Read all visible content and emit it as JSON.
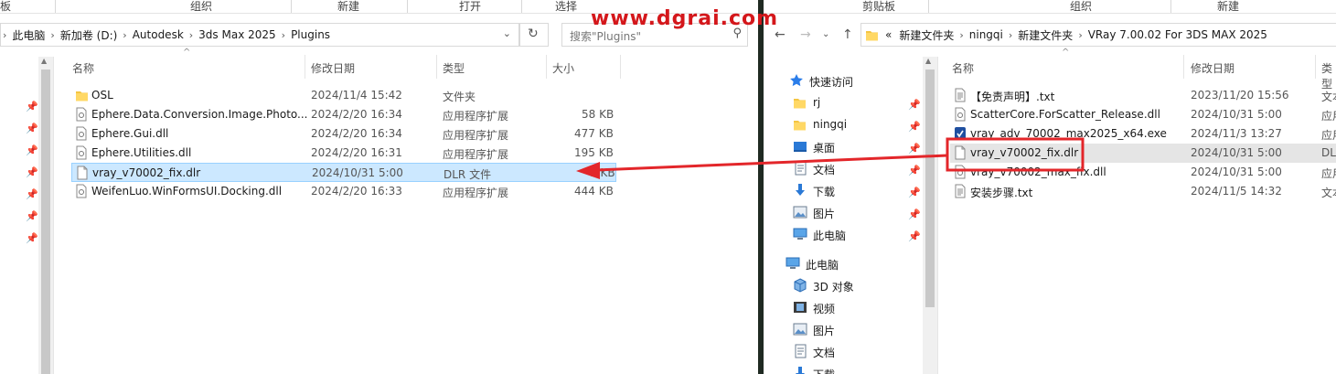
{
  "left": {
    "ribbon": [
      "板",
      "组织",
      "新建",
      "打开",
      "选择"
    ],
    "breadcrumb": [
      "此电脑",
      "新加卷 (D:)",
      "Autodesk",
      "3ds Max 2025",
      "Plugins"
    ],
    "search_placeholder": "搜索\"Plugins\"",
    "columns": {
      "name": "名称",
      "date": "修改日期",
      "type": "类型",
      "size": "大小"
    },
    "files": [
      {
        "icon": "folder-icon",
        "name": "OSL",
        "date": "2024/11/4 15:42",
        "type": "文件夹",
        "size": ""
      },
      {
        "icon": "dll-file-icon",
        "name": "Ephere.Data.Conversion.Image.Photo...",
        "date": "2024/2/20 16:34",
        "type": "应用程序扩展",
        "size": "58 KB"
      },
      {
        "icon": "dll-file-icon",
        "name": "Ephere.Gui.dll",
        "date": "2024/2/20 16:34",
        "type": "应用程序扩展",
        "size": "477 KB"
      },
      {
        "icon": "dll-file-icon",
        "name": "Ephere.Utilities.dll",
        "date": "2024/2/20 16:31",
        "type": "应用程序扩展",
        "size": "195 KB"
      },
      {
        "icon": "generic-file-icon",
        "name": "vray_v70002_fix.dlr",
        "date": "2024/10/31 5:00",
        "type": "DLR 文件",
        "size": "3 KB"
      },
      {
        "icon": "dll-file-icon",
        "name": "WeifenLuo.WinFormsUI.Docking.dll",
        "date": "2024/2/20 16:33",
        "type": "应用程序扩展",
        "size": "444 KB"
      }
    ]
  },
  "right": {
    "ribbon": [
      "剪贴板",
      "组织",
      "新建"
    ],
    "breadcrumb_prefix": "«",
    "breadcrumb": [
      "新建文件夹",
      "ningqi",
      "新建文件夹",
      "VRay 7.00.02 For 3DS MAX 2025"
    ],
    "columns": {
      "name": "名称",
      "date": "修改日期",
      "type": "类型"
    },
    "sidebar": [
      {
        "icon": "star-icon",
        "label": "快速访问",
        "pin": false
      },
      {
        "icon": "folder-icon",
        "label": "rj",
        "pin": true
      },
      {
        "icon": "folder-icon",
        "label": "ningqi",
        "pin": true
      },
      {
        "icon": "desktop-icon",
        "label": "桌面",
        "pin": true
      },
      {
        "icon": "document-icon",
        "label": "文档",
        "pin": true
      },
      {
        "icon": "download-icon",
        "label": "下载",
        "pin": true
      },
      {
        "icon": "picture-icon",
        "label": "图片",
        "pin": true
      },
      {
        "icon": "computer-icon",
        "label": "此电脑",
        "pin": true
      },
      {
        "icon": "computer-icon",
        "label": "此电脑",
        "pin": false
      },
      {
        "icon": "cube-3d-icon",
        "label": "3D 对象",
        "pin": false
      },
      {
        "icon": "video-icon",
        "label": "视频",
        "pin": false
      },
      {
        "icon": "picture-icon",
        "label": "图片",
        "pin": false
      },
      {
        "icon": "document-icon",
        "label": "文档",
        "pin": false
      },
      {
        "icon": "download-icon",
        "label": "下载",
        "pin": false
      }
    ],
    "files": [
      {
        "icon": "text-file-icon",
        "name": "【免责声明】.txt",
        "date": "2023/11/20 15:56",
        "type": "文本"
      },
      {
        "icon": "dll-file-icon",
        "name": "ScatterCore.ForScatter_Release.dll",
        "date": "2024/10/31 5:00",
        "type": "应用"
      },
      {
        "icon": "installer-icon",
        "name": "vray_adv_70002_max2025_x64.exe",
        "date": "2024/11/3 13:27",
        "type": "应用"
      },
      {
        "icon": "generic-file-icon",
        "name": "vray_v70002_fix.dlr",
        "date": "2024/10/31 5:00",
        "type": "DL"
      },
      {
        "icon": "dll-file-icon",
        "name": "vray_v70002_max_fix.dll",
        "date": "2024/10/31 5:00",
        "type": "应用"
      },
      {
        "icon": "text-file-icon",
        "name": "安装步骤.txt",
        "date": "2024/11/5 14:32",
        "type": "文本"
      }
    ]
  },
  "watermark": "www.dgrai.com",
  "colors": {
    "accent_selected": "#cce8ff",
    "annotation": "#e3262a",
    "folder": "#f4c542"
  }
}
